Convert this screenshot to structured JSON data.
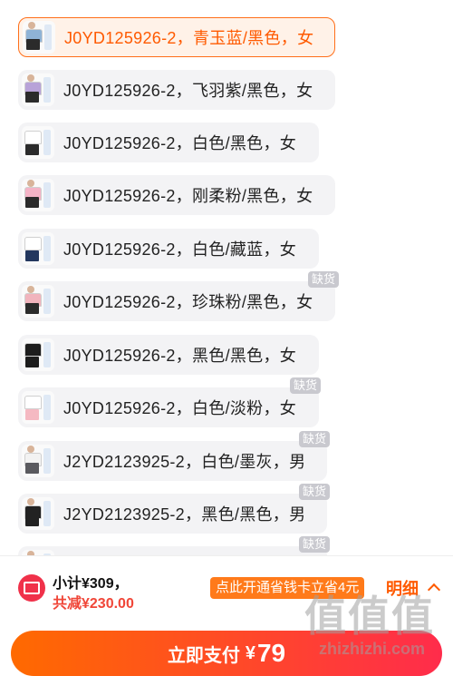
{
  "options": [
    {
      "label": "J0YD125926-2，青玉蓝/黑色，女",
      "selected": true,
      "shirt": "#8fb3d6",
      "pants": "#2b2b2b",
      "person": true
    },
    {
      "label": "J0YD125926-2，飞羽紫/黑色，女",
      "selected": false,
      "shirt": "#b8a2d8",
      "pants": "#2b2b2b",
      "person": true
    },
    {
      "label": "J0YD125926-2，白色/黑色，女",
      "selected": false,
      "shirt": "#ffffff",
      "pants": "#2b2b2b",
      "person": false
    },
    {
      "label": "J0YD125926-2，刚柔粉/黑色，女",
      "selected": false,
      "shirt": "#f4b3c6",
      "pants": "#2b2b2b",
      "person": true
    },
    {
      "label": "J0YD125926-2，白色/藏蓝，女",
      "selected": false,
      "shirt": "#ffffff",
      "pants": "#23375e",
      "person": false
    },
    {
      "label": "J0YD125926-2，珍珠粉/黑色，女",
      "selected": false,
      "shirt": "#f1b4bd",
      "pants": "#2b2b2b",
      "person": true,
      "badge": "缺货"
    },
    {
      "label": "J0YD125926-2，黑色/黑色，女",
      "selected": false,
      "shirt": "#1d1d1d",
      "pants": "#1d1d1d",
      "person": false
    },
    {
      "label": "J0YD125926-2，白色/淡粉，女",
      "selected": false,
      "shirt": "#ffffff",
      "pants": "#f5b9c2",
      "person": false,
      "badge": "缺货"
    },
    {
      "label": "J2YD2123925-2，白色/墨灰，男",
      "selected": false,
      "shirt": "#f2f2f2",
      "pants": "#5a5a5f",
      "person": true,
      "badge": "缺货"
    },
    {
      "label": "J2YD2123925-2，黑色/黑色，男",
      "selected": false,
      "shirt": "#222222",
      "pants": "#222222",
      "person": true,
      "badge": "缺货"
    },
    {
      "label": "",
      "selected": false,
      "shirt": "#cccccc",
      "pants": "#555555",
      "person": true,
      "badge": "缺货"
    }
  ],
  "footer": {
    "subtotal": "小计¥309，",
    "discount": "共减¥230.00",
    "promo": "点此开通省钱卡立省4元",
    "detail": "明细",
    "pay_label": "立即支付",
    "pay_currency": "¥",
    "pay_amount": "79"
  },
  "watermark": {
    "chars": "值值值",
    "url": "zhizhizhi.com"
  },
  "colors": {
    "accent": "#ff5a00",
    "pay_start": "#ff6a00",
    "pay_end": "#ff2c4b",
    "discount": "#f04638"
  }
}
